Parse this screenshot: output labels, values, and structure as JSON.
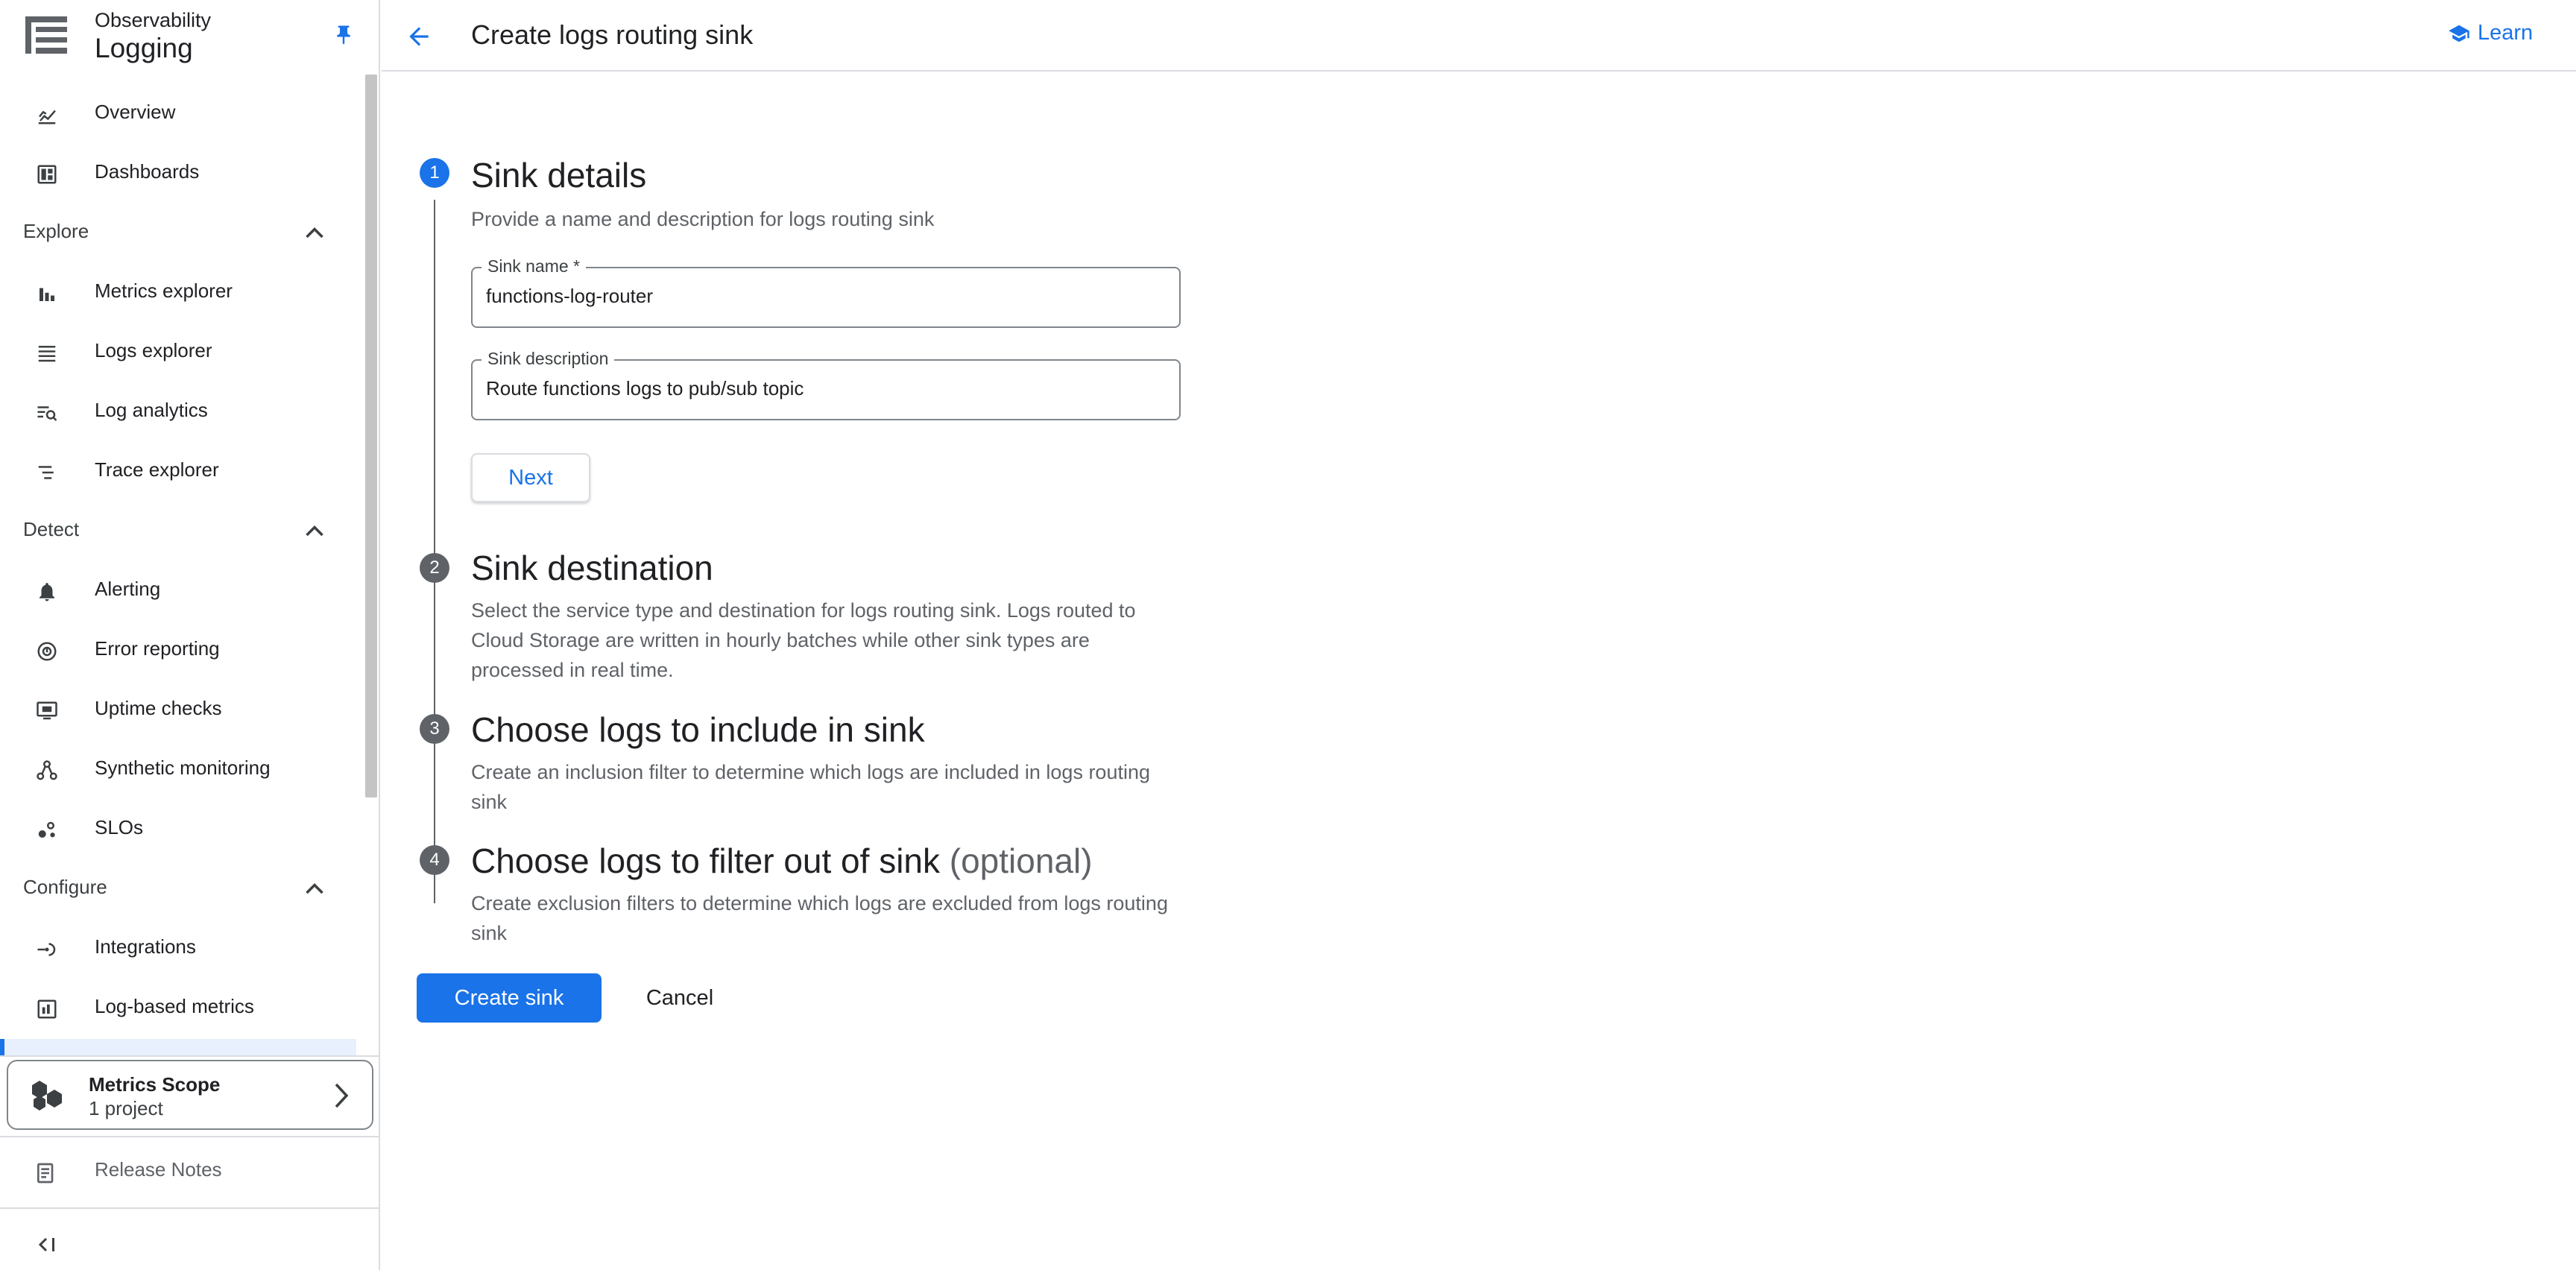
{
  "app": {
    "product_group": "Observability",
    "product": "Logging"
  },
  "sidebar": {
    "items": [
      {
        "label": "Overview",
        "icon": "chart-line-icon"
      },
      {
        "label": "Dashboards",
        "icon": "dashboard-icon"
      }
    ],
    "sections": [
      {
        "label": "Explore",
        "items": [
          {
            "label": "Metrics explorer",
            "icon": "bar-chart-icon"
          },
          {
            "label": "Logs explorer",
            "icon": "list-icon"
          },
          {
            "label": "Log analytics",
            "icon": "list-search-icon"
          },
          {
            "label": "Trace explorer",
            "icon": "trace-icon"
          }
        ]
      },
      {
        "label": "Detect",
        "items": [
          {
            "label": "Alerting",
            "icon": "bell-icon"
          },
          {
            "label": "Error reporting",
            "icon": "error-reporting-icon"
          },
          {
            "label": "Uptime checks",
            "icon": "monitor-icon"
          },
          {
            "label": "Synthetic monitoring",
            "icon": "synthetic-icon"
          },
          {
            "label": "SLOs",
            "icon": "slo-icon"
          }
        ]
      },
      {
        "label": "Configure",
        "items": [
          {
            "label": "Integrations",
            "icon": "integrations-icon"
          },
          {
            "label": "Log-based metrics",
            "icon": "log-metrics-icon"
          }
        ]
      }
    ],
    "metrics_scope": {
      "title": "Metrics Scope",
      "subtitle": "1 project"
    },
    "release_notes": "Release Notes"
  },
  "header": {
    "title": "Create logs routing sink",
    "learn_label": "Learn"
  },
  "steps": [
    {
      "number": "1",
      "title": "Sink details",
      "description": "Provide a name and description for logs routing sink"
    },
    {
      "number": "2",
      "title": "Sink destination",
      "description": "Select the service type and destination for logs routing sink. Logs routed to Cloud Storage are written in hourly batches while other sink types are processed in real time."
    },
    {
      "number": "3",
      "title": "Choose logs to include in sink",
      "description": "Create an inclusion filter to determine which logs are included in logs routing sink"
    },
    {
      "number": "4",
      "title": "Choose logs to filter out of sink",
      "title_suffix": "(optional)",
      "description": "Create exclusion filters to determine which logs are excluded from logs routing sink"
    }
  ],
  "form": {
    "sink_name": {
      "label": "Sink name *",
      "value": "functions-log-router"
    },
    "sink_description": {
      "label": "Sink description",
      "value": "Route functions logs to pub/sub topic"
    },
    "next_label": "Next",
    "create_label": "Create sink",
    "cancel_label": "Cancel"
  },
  "colors": {
    "accent": "#1a73e8",
    "inactive_step": "#5f6368"
  }
}
